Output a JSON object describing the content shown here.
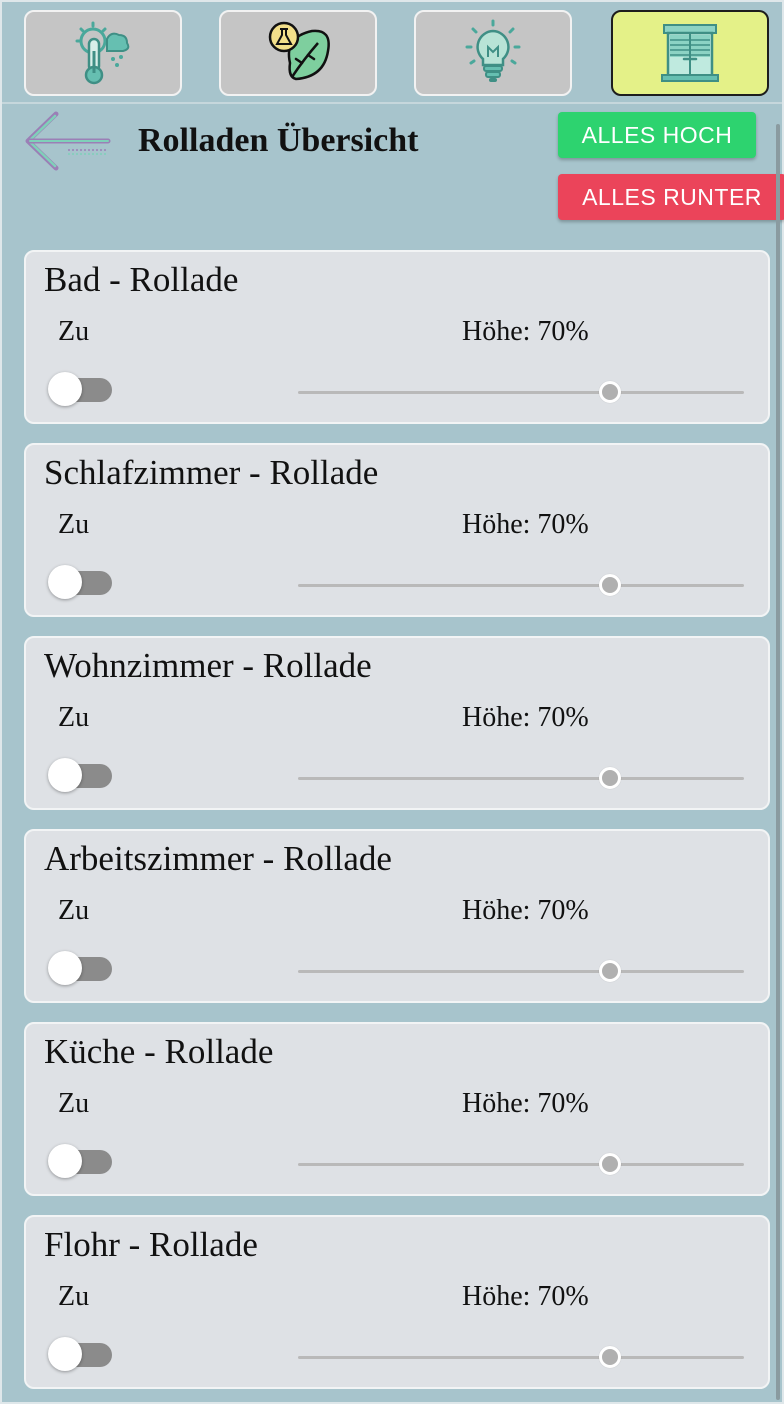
{
  "tabs": [
    {
      "icon": "thermometer-weather-icon",
      "active": false
    },
    {
      "icon": "plant-leaf-icon",
      "active": false
    },
    {
      "icon": "light-bulb-icon",
      "active": false
    },
    {
      "icon": "window-shutter-icon",
      "active": true
    }
  ],
  "header": {
    "back_icon": "arrow-left-icon",
    "title": "Rolladen Übersicht",
    "all_up_label": "ALLES HOCH",
    "all_down_label": "ALLES RUNTER"
  },
  "colors": {
    "background": "#a7c4cc",
    "active_tab": "#e4f188",
    "all_up": "#2dd36f",
    "all_down": "#eb445a",
    "icon_teal": "#4aa89b"
  },
  "shutters": [
    {
      "name": "Bad - Rollade",
      "state": "Zu",
      "height_label": "Höhe: 70%",
      "height_value": 70,
      "toggle_on": false
    },
    {
      "name": "Schlafzimmer - Rollade",
      "state": "Zu",
      "height_label": "Höhe: 70%",
      "height_value": 70,
      "toggle_on": false
    },
    {
      "name": "Wohnzimmer - Rollade",
      "state": "Zu",
      "height_label": "Höhe: 70%",
      "height_value": 70,
      "toggle_on": false
    },
    {
      "name": "Arbeitszimmer - Rollade",
      "state": "Zu",
      "height_label": "Höhe: 70%",
      "height_value": 70,
      "toggle_on": false
    },
    {
      "name": "Küche - Rollade",
      "state": "Zu",
      "height_label": "Höhe: 70%",
      "height_value": 70,
      "toggle_on": false
    },
    {
      "name": "Flohr - Rollade",
      "state": "Zu",
      "height_label": "Höhe: 70%",
      "height_value": 70,
      "toggle_on": false
    }
  ]
}
